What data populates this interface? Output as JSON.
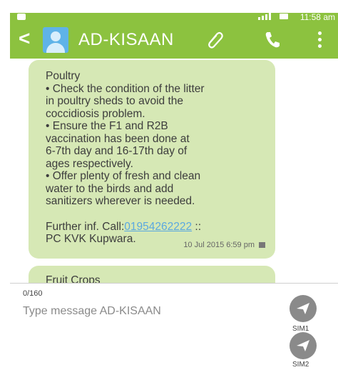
{
  "status_bar": {
    "time": "11:58 am"
  },
  "header": {
    "title": "AD-KISAAN"
  },
  "messages": [
    {
      "lines": [
        "Poultry",
        "• Check the condition of the litter",
        "in poultry sheds to avoid the",
        "coccidiosis problem.",
        "• Ensure the F1 and R2B",
        "vaccination has been done at",
        "6-7th day and 16-17th day of",
        "ages respectively.",
        "• Offer plenty of fresh and clean",
        "water to the birds and add",
        "sanitizers wherever is needed."
      ],
      "further_prefix": "Further inf. Call:",
      "phone": "01954262222",
      "further_suffix": " ::",
      "signature": "PC KVK Kupwara.",
      "timestamp": "10 Jul 2015 6:59 pm"
    },
    {
      "preview": "Fruit Crops"
    }
  ],
  "compose": {
    "counter": "0/160",
    "placeholder": "Type message AD-KISAAN",
    "sim1_label": "SIM1",
    "sim2_label": "SIM2"
  }
}
